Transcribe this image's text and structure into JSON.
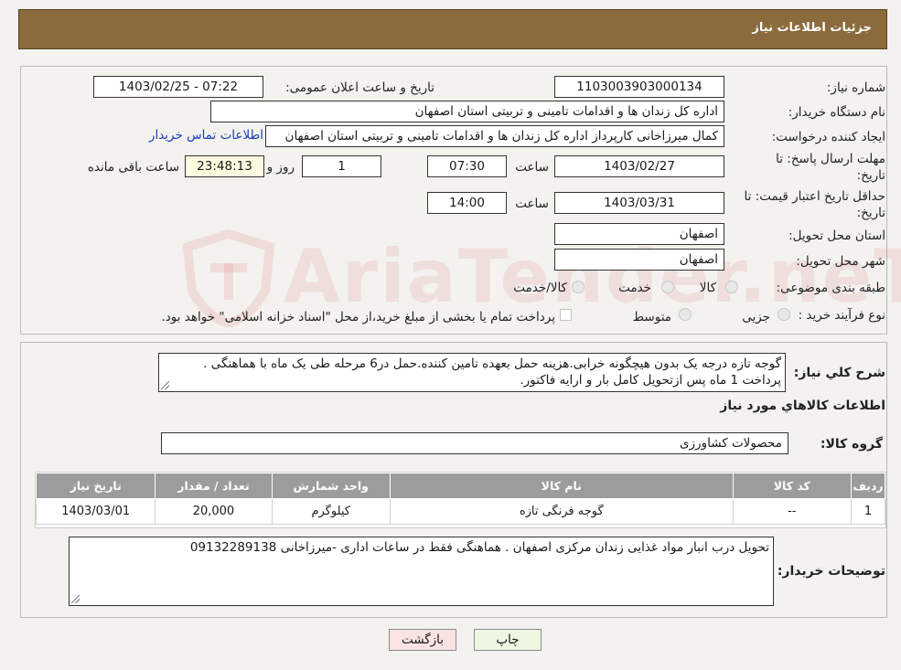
{
  "header": {
    "title": "جزئیات اطلاعات نیاز"
  },
  "form": {
    "need_number_label": "شماره نیاز:",
    "need_number": "1103003903000134",
    "announce_label": "تاریخ و ساعت اعلان عمومی:",
    "announce_value": "1403/02/25 - 07:22",
    "buyer_org_label": "نام دستگاه خریدار:",
    "buyer_org": "اداره کل زندان ها و اقدامات تامینی و تربیتی استان اصفهان",
    "creator_label": "ایجاد کننده درخواست:",
    "creator": "کمال میرزاخانی کارپرداز اداره کل زندان ها و اقدامات تامینی و تربیتی استان اصفهان",
    "contact_link": "اطلاعات تماس خریدار",
    "deadline_label_line1": "مهلت ارسال پاسخ: تا",
    "deadline_label_line2": "تاریخ:",
    "deadline_date": "1403/02/27",
    "time_label": "ساعت",
    "deadline_time": "07:30",
    "days_value": "1",
    "days_label": "روز و",
    "remaining_time": "23:48:13",
    "remaining_label": "ساعت باقی مانده",
    "min_validity_label_line1": "حداقل تاریخ اعتبار قیمت: تا",
    "min_validity_label_line2": "تاریخ:",
    "min_validity_date": "1403/03/31",
    "min_validity_time": "14:00",
    "province_label": "استان محل تحویل:",
    "province": "اصفهان",
    "city_label": "شهر محل تحویل:",
    "city": "اصفهان",
    "category_label": "طبقه بندی موضوعی:",
    "category_options": [
      "کالا",
      "خدمت",
      "کالا/خدمت"
    ],
    "process_label": "نوع فرآیند خرید :",
    "process_options": [
      "جزیی",
      "متوسط"
    ],
    "process_note": "پرداخت تمام یا بخشی از مبلغ خرید،از محل \"اسناد خزانه اسلامی\" خواهد بود."
  },
  "details": {
    "description_label": "شرح کلي نياز:",
    "description": "گوجه تازه درجه یک بدون هیچگونه خرابی.هزینه حمل بعهده تامین کننده.حمل در6 مرحله طی یک ماه با هماهنگی . پرداخت 1 ماه پس ازتحویل کامل بار و ارایه فاکتور.",
    "goods_info_title": "اطلاعات کالاهاي مورد نياز",
    "goods_group_label": "گروه کالا:",
    "goods_group": "محصولات کشاورزی",
    "table": {
      "headers": [
        "ردیف",
        "کد کالا",
        "نام کالا",
        "واحد شمارش",
        "تعداد / مقدار",
        "تاریخ نیاز"
      ],
      "rows": [
        [
          "1",
          "--",
          "گوجه فرنگی تازه",
          "کیلوگرم",
          "20,000",
          "1403/03/01"
        ]
      ]
    },
    "buyer_notes_label": "توضیحات خریدار:",
    "buyer_notes": "تحویل درب انبار مواد غذایی زندان مرکزی اصفهان . هماهنگی فقط در ساعات اداری -میرزاخانی 09132289138"
  },
  "buttons": {
    "print": "چاپ",
    "back": "بازگشت"
  },
  "watermark": {
    "text": "AriaTender.neT"
  },
  "colors": {
    "header_bg": "#8b6a3d",
    "table_header_bg": "#9c9c9c",
    "link": "#1a3db8",
    "back_button_bg": "#fbe3e3",
    "print_button_bg": "#eef7e2"
  }
}
